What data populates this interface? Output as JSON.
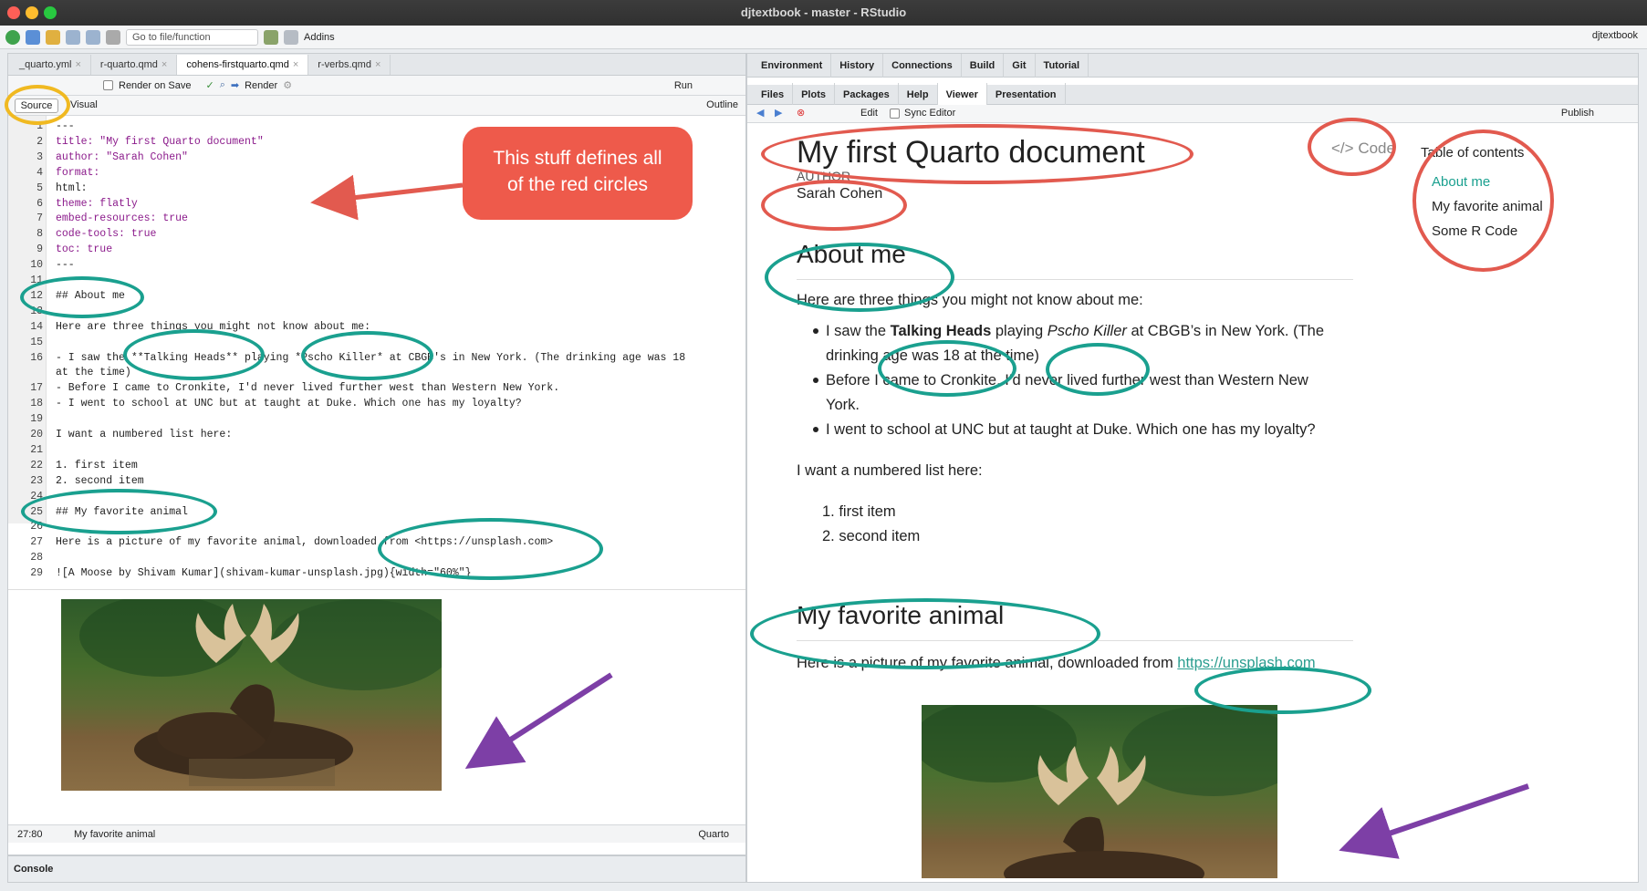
{
  "window": {
    "title": "djtextbook - master - RStudio"
  },
  "toolbar": {
    "goto_placeholder": "Go to file/function",
    "addins": "Addins",
    "project": "djtextbook"
  },
  "doc_tabs": [
    "_quarto.yml",
    "r-quarto.qmd",
    "cohens-firstquarto.qmd",
    "r-verbs.qmd"
  ],
  "editor_toolbar": {
    "render_on_save": "Render on Save",
    "render": "Render",
    "run": "Run"
  },
  "mode": {
    "source": "Source",
    "visual": "Visual",
    "outline": "Outline"
  },
  "code_lines": [
    {
      "n": "1",
      "t": "---"
    },
    {
      "n": "2",
      "t": "title: \"My first Quarto document\""
    },
    {
      "n": "3",
      "t": "author: \"Sarah Cohen\""
    },
    {
      "n": "4",
      "t": "format:"
    },
    {
      "n": "5",
      "t": "  html:"
    },
    {
      "n": "6",
      "t": "    theme: flatly"
    },
    {
      "n": "7",
      "t": "    embed-resources: true"
    },
    {
      "n": "8",
      "t": "    code-tools: true"
    },
    {
      "n": "9",
      "t": "    toc: true"
    },
    {
      "n": "10",
      "t": "---"
    },
    {
      "n": "11",
      "t": ""
    },
    {
      "n": "12",
      "t": "## About me"
    },
    {
      "n": "13",
      "t": ""
    },
    {
      "n": "14",
      "t": "Here are three things you might not know about me:"
    },
    {
      "n": "15",
      "t": ""
    },
    {
      "n": "16",
      "t": "-   I saw the **Talking Heads** playing *Pscho Killer* at CBGB's in New York. (The drinking age was 18"
    },
    {
      "n": "",
      "t": "at the time)"
    },
    {
      "n": "17",
      "t": "-   Before I came to Cronkite, I'd never lived further west than Western New York."
    },
    {
      "n": "18",
      "t": "-   I went to school at UNC but at taught at Duke. Which one has my loyalty?"
    },
    {
      "n": "19",
      "t": ""
    },
    {
      "n": "20",
      "t": "I want a numbered list here:"
    },
    {
      "n": "21",
      "t": ""
    },
    {
      "n": "22",
      "t": "1.  first item"
    },
    {
      "n": "23",
      "t": "2.  second item"
    },
    {
      "n": "24",
      "t": ""
    },
    {
      "n": "25",
      "t": "## My favorite animal"
    },
    {
      "n": "26",
      "t": ""
    },
    {
      "n": "27",
      "t": "Here is a picture of my favorite animal, downloaded from <https://unsplash.com>"
    },
    {
      "n": "28",
      "t": ""
    },
    {
      "n": "29",
      "t": "![A Moose by Shivam Kumar](shivam-kumar-unsplash.jpg){width=\"60%\"}"
    }
  ],
  "status": {
    "position": "27:80",
    "section": "My favorite animal",
    "filetype": "Quarto"
  },
  "console": {
    "label": "Console"
  },
  "right_tabs_top": [
    "Environment",
    "History",
    "Connections",
    "Build",
    "Git",
    "Tutorial"
  ],
  "right_tabs_bottom": [
    "Files",
    "Plots",
    "Packages",
    "Help",
    "Viewer",
    "Presentation"
  ],
  "viewer_toolbar": {
    "edit": "Edit",
    "sync_editor": "Sync Editor",
    "publish": "Publish"
  },
  "doc": {
    "title": "My first Quarto document",
    "code_button": "Code",
    "author_label": "AUTHOR",
    "author": "Sarah Cohen",
    "h_about": "About me",
    "intro": "Here are three things you might not know about me:",
    "b1_a": "I saw the ",
    "b1_bold": "Talking Heads",
    "b1_b": " playing ",
    "b1_italic": "Pscho Killer",
    "b1_c": " at CBGB’s in New York. (The",
    "b1_d": "drinking age was 18 at the time)",
    "b2_a": "Before I came to Cronkite, I’d never lived further west than Western New",
    "b2_b": "York.",
    "b3": "I went to school at UNC but at taught at Duke. Which one has my loyalty?",
    "numbered_intro": "I want a numbered list here:",
    "n1": "1. first item",
    "n2": "2. second item",
    "h_animal": "My favorite animal",
    "pic_text": "Here is a picture of my favorite animal, downloaded from ",
    "link": "https://unsplash.com"
  },
  "toc": {
    "title": "Table of contents",
    "items": [
      "About me",
      "My favorite animal",
      "Some R Code"
    ]
  },
  "callout": {
    "line1": "This stuff defines all",
    "line2": "of the red circles"
  },
  "colors": {
    "red": "#e25a4f",
    "teal": "#1aa08f",
    "gold": "#f0b921",
    "purple": "#7d3fa6",
    "link": "#2a9d8f"
  }
}
